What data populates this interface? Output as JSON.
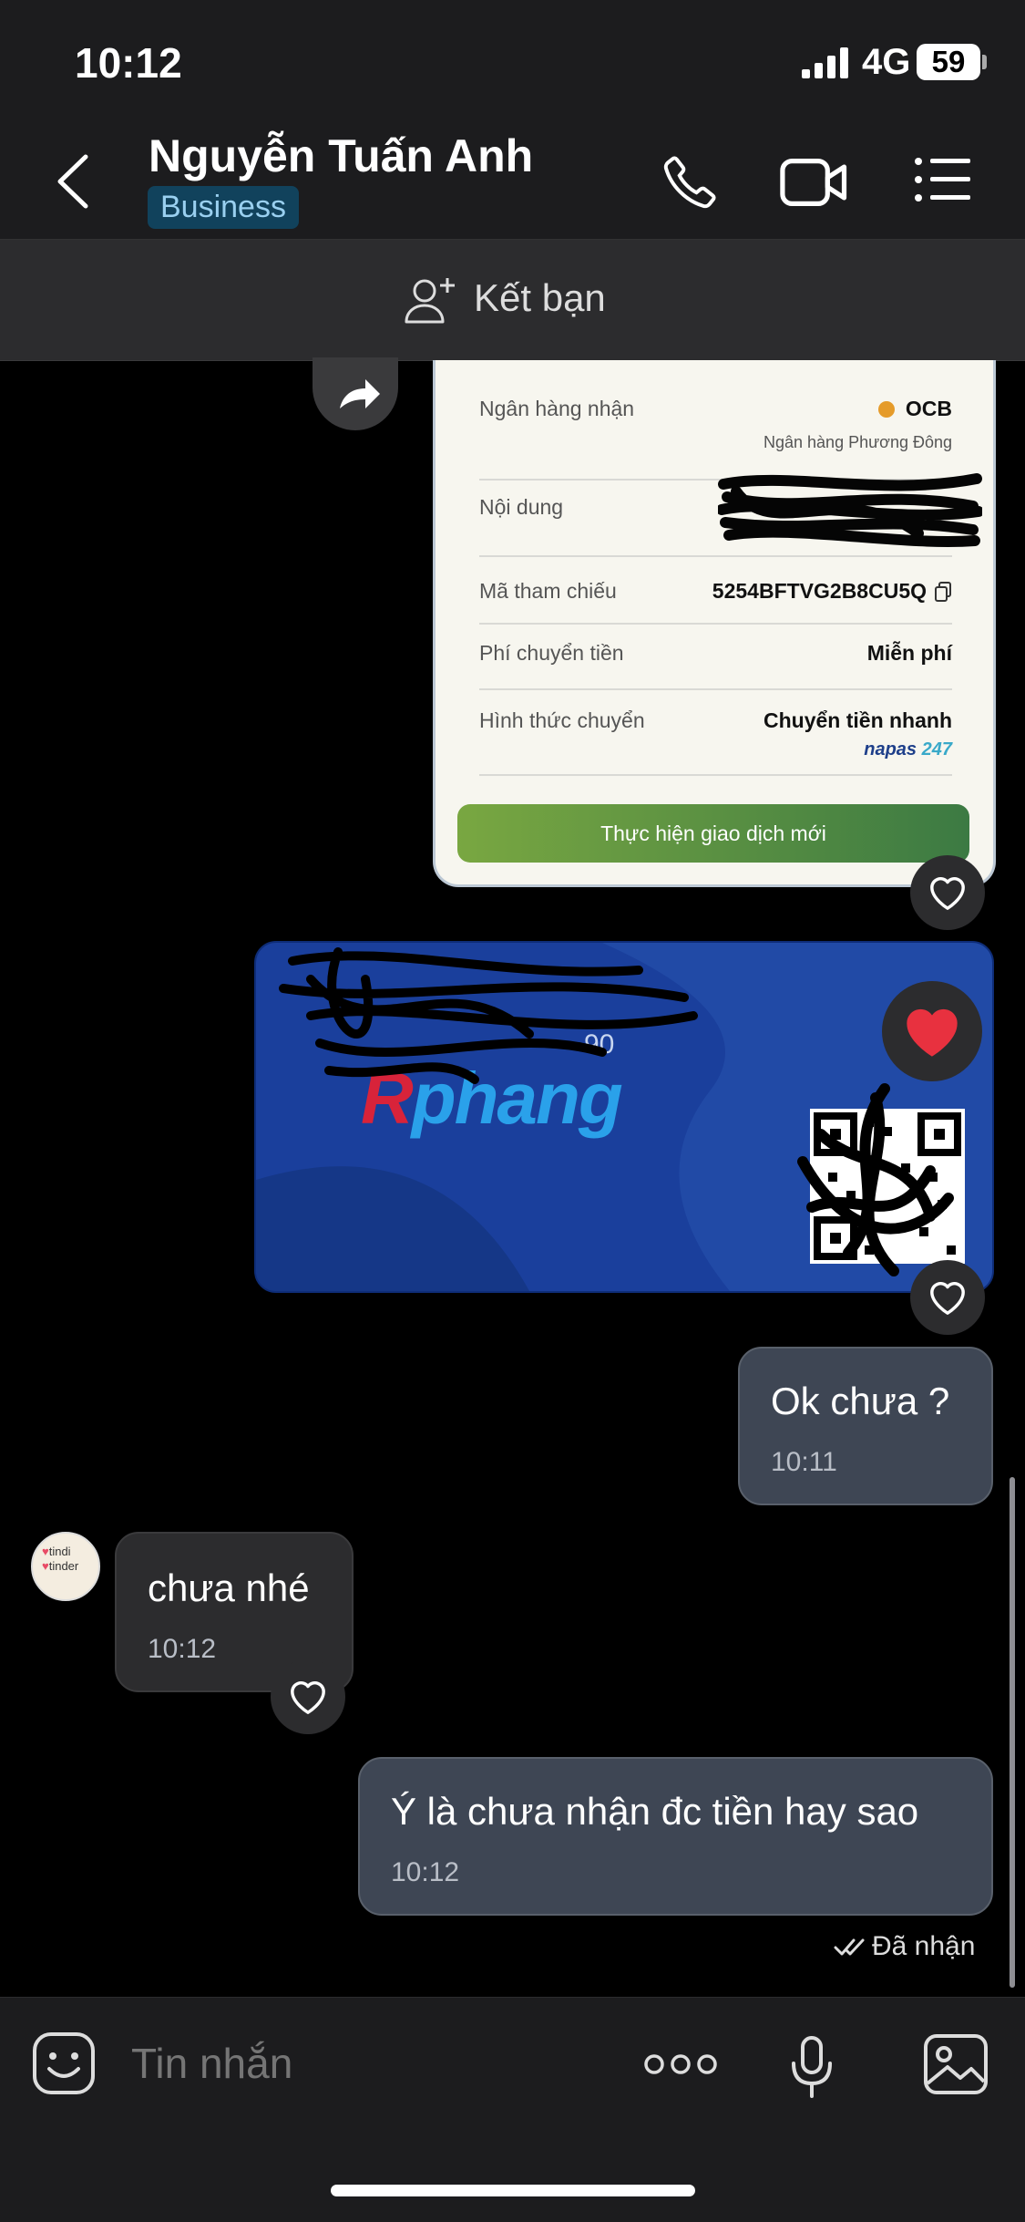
{
  "status_bar": {
    "time": "10:12",
    "network": "4G",
    "battery": "59"
  },
  "header": {
    "contact_name": "Nguyễn Tuấn Anh",
    "badge": "Business",
    "icons": [
      "back-icon",
      "phone-icon",
      "video-icon",
      "menu-icon"
    ]
  },
  "add_friend": {
    "label": "Kết bạn"
  },
  "receipt": {
    "rows": [
      {
        "label": "Ngân hàng nhận",
        "value": "OCB",
        "sub": "Ngân hàng Phương Đông"
      },
      {
        "label": "Nội dung",
        "value": ""
      },
      {
        "label": "Mã tham chiếu",
        "value": "5254BFTVG2B8CU5Q"
      },
      {
        "label": "Phí chuyển tiền",
        "value": "Miễn phí"
      },
      {
        "label": "Hình thức chuyển",
        "value": "Chuyển tiền nhanh"
      }
    ],
    "napas": "napas",
    "napas_num": "247",
    "button": "Thực hiện giao dịch mới"
  },
  "card": {
    "brand_first": "R",
    "brand_rest": "phang",
    "number_fragment": "90"
  },
  "messages": [
    {
      "side": "right",
      "text": "Ok chưa ?",
      "time": "10:11"
    },
    {
      "side": "left",
      "text": "chưa nhé",
      "time": "10:12"
    },
    {
      "side": "right",
      "text": "Ý là chưa nhận đc tiền hay sao",
      "time": "10:12"
    }
  ],
  "avatar_text": [
    "tindi",
    "tinder"
  ],
  "seen_status": "Đã nhận",
  "composer": {
    "placeholder": "Tin nhắn"
  },
  "colors": {
    "bubble_mine": "#3e4654",
    "bubble_theirs": "#2c2c2e",
    "background": "#000000"
  }
}
